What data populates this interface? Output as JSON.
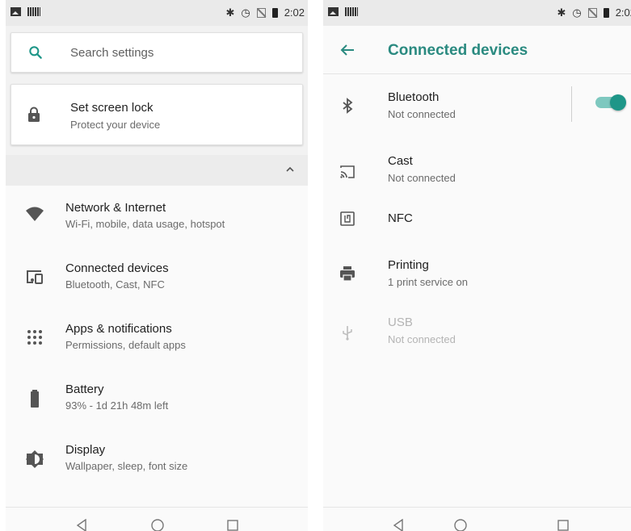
{
  "statusbar": {
    "time": "2:02",
    "bluetooth_glyph": "✱",
    "alarm_glyph": "◷"
  },
  "settings_home": {
    "search": {
      "placeholder": "Search settings",
      "icon": "search-icon"
    },
    "suggestion": {
      "title": "Set screen lock",
      "subtitle": "Protect your device",
      "icon": "lock-icon"
    },
    "collapse_icon": "chevron-up-icon",
    "items": [
      {
        "title": "Network & Internet",
        "subtitle": "Wi-Fi, mobile, data usage, hotspot",
        "icon": "wifi-icon"
      },
      {
        "title": "Connected devices",
        "subtitle": "Bluetooth, Cast, NFC",
        "icon": "connected-devices-icon"
      },
      {
        "title": "Apps & notifications",
        "subtitle": "Permissions, default apps",
        "icon": "apps-grid-icon"
      },
      {
        "title": "Battery",
        "subtitle": "93% - 1d 21h 48m left",
        "icon": "battery-icon"
      },
      {
        "title": "Display",
        "subtitle": "Wallpaper, sleep, font size",
        "icon": "brightness-icon"
      }
    ]
  },
  "connected_devices": {
    "title": "Connected devices",
    "accent_color": "#2a8a80",
    "items": [
      {
        "title": "Bluetooth",
        "subtitle": "Not connected",
        "icon": "bluetooth-icon",
        "toggle_on": true
      },
      {
        "title": "Cast",
        "subtitle": "Not connected",
        "icon": "cast-icon"
      },
      {
        "title": "NFC",
        "subtitle": "",
        "icon": "nfc-icon"
      },
      {
        "title": "Printing",
        "subtitle": "1 print service on",
        "icon": "printer-icon"
      },
      {
        "title": "USB",
        "subtitle": "Not connected",
        "icon": "usb-icon",
        "disabled": true
      }
    ]
  }
}
